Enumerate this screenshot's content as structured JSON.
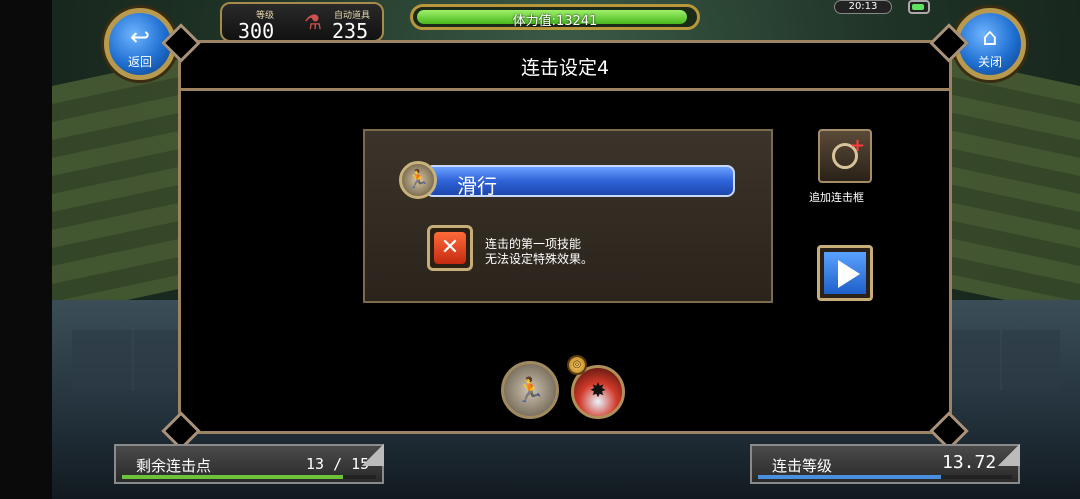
{
  "hud": {
    "level_label": "等级",
    "level_value": "300",
    "auto_item_label": "自动道具",
    "auto_item_value": "235",
    "stamina_text": "体力值:13241",
    "stamina_fraction": 0.98,
    "clock": "20:13"
  },
  "nav": {
    "back_label": "返回",
    "close_label": "关闭"
  },
  "panel": {
    "title": "连击设定4",
    "skill_name": "滑行",
    "note_line1": "连击的第一项技能",
    "note_line2": "无法设定特殊效果。",
    "add_frame_label": "追加连击框"
  },
  "bottom": {
    "remaining_label": "剩余连击点",
    "remaining_value": "13 / 15",
    "remaining_fraction": 0.87,
    "combo_level_label": "连击等级",
    "combo_level_value": "13.72",
    "combo_level_fraction": 0.72
  },
  "colors": {
    "panel_border": "#9c8460",
    "skill_bar": "#2f63d8",
    "stamina": "#48b81e",
    "remaining_fill": "#6cc23a",
    "combo_fill": "#4a8ee0"
  },
  "icons": {
    "back": "back-arrow-icon",
    "close": "home-icon",
    "skill": "slide-skill-icon",
    "cancel": "x-icon",
    "add": "add-combo-frame-icon",
    "next": "play-triangle-icon"
  }
}
